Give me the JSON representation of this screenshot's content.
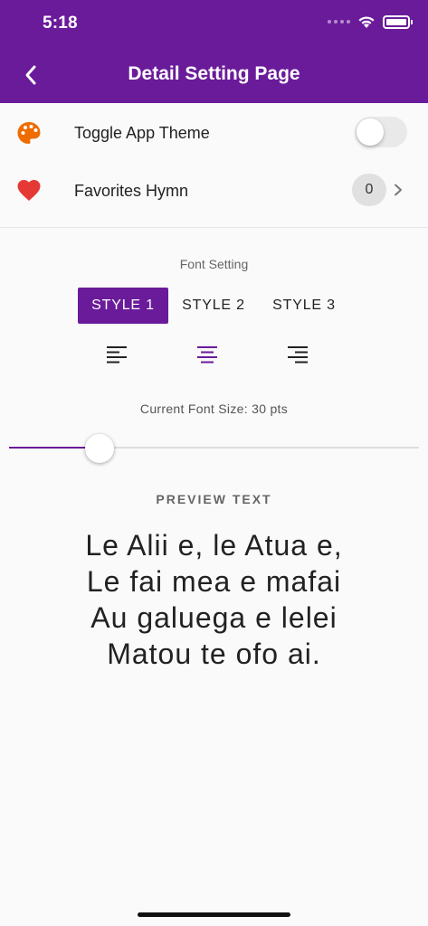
{
  "status_bar": {
    "time": "5:18",
    "icons": [
      "signal-dots-icon",
      "wifi-icon",
      "battery-icon"
    ]
  },
  "header": {
    "title": "Detail Setting Page",
    "back_icon": "chevron-left-icon",
    "color": "#6a1b9a"
  },
  "settings": {
    "theme_toggle": {
      "label": "Toggle App Theme",
      "icon": "palette-icon",
      "icon_color": "#ef6c00",
      "on": false
    },
    "favorites": {
      "label": "Favorites Hymn",
      "icon": "heart-icon",
      "icon_color": "#e53935",
      "count": "0"
    }
  },
  "font_setting": {
    "label": "Font Setting",
    "styles": [
      "STYLE 1",
      "STYLE 2",
      "STYLE 3"
    ],
    "selected_style": "STYLE 1",
    "alignments": [
      "align-left-icon",
      "align-center-icon",
      "align-right-icon"
    ],
    "selected_alignment": "align-center-icon",
    "current_size_label": "Current Font Size: 30 pts",
    "slider_value_fraction": 0.22,
    "accent_color": "#6a1b9a"
  },
  "preview": {
    "label": "PREVIEW TEXT",
    "lines": [
      "Le Alii e, le Atua e,",
      "Le fai mea e mafai",
      "Au galuega e lelei",
      "Matou te ofo ai."
    ]
  }
}
